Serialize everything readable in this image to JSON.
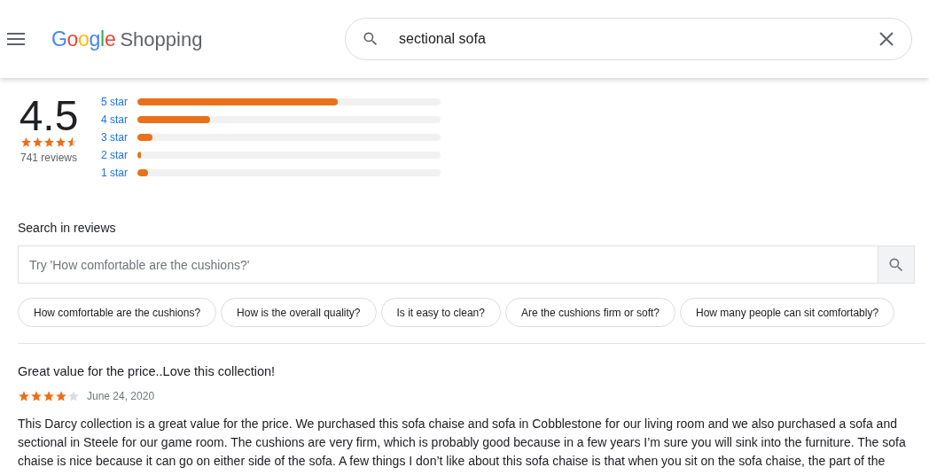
{
  "header": {
    "brand": "Google",
    "product": "Shopping",
    "search": {
      "value": "sectional sofa"
    }
  },
  "rating": {
    "score": "4.5",
    "stars": 4.5,
    "count": "741 reviews",
    "bars": [
      {
        "label": "5 star",
        "level": 0.66
      },
      {
        "label": "4 star",
        "level": 0.24
      },
      {
        "label": "3 star",
        "level": 0.05
      },
      {
        "label": "2 star",
        "level": 0.012
      },
      {
        "label": "1 star",
        "level": 0.035
      }
    ]
  },
  "review_search": {
    "label": "Search in reviews",
    "placeholder": "Try 'How comfortable are the cushions?'",
    "suggestions": [
      "How comfortable are the cushions?",
      "How is the overall quality?",
      "Is it easy to clean?",
      "Are the cushions firm or soft?",
      "How many people can sit comfortably?"
    ]
  },
  "reviews": [
    {
      "title": "Great value for the price..Love this collection!",
      "stars": 4,
      "date": "June 24, 2020",
      "body": "This Darcy collection is a great value for the price. We purchased this sofa chaise and sofa in Cobblestone for our living room and we also purchased a sofa and sectional in Steele for our game room. The cushions are very firm, which is probably good because in a few years I’m sure you will sink into the furniture. The sofa chaise is nice because it can go on either side of the sofa. A few things I don’t like about this sofa chaise is that when you sit on the sofa chaise, the part of the"
    }
  ]
}
